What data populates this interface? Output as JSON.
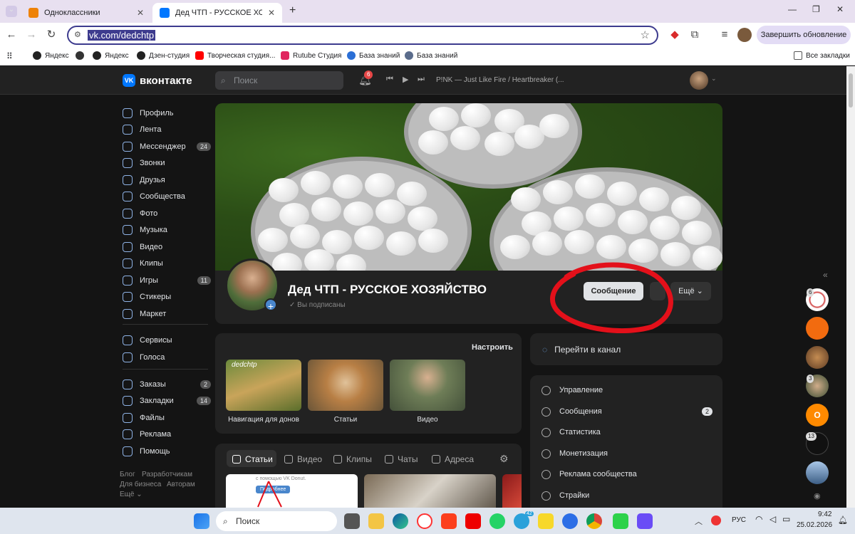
{
  "browser": {
    "tabs": [
      {
        "label": "Одноклассники",
        "active": false
      },
      {
        "label": "Дед ЧТП - РУССКОЕ ХОЗЯЙСТВО",
        "active": true
      }
    ],
    "url": "vk.com/dedchtp",
    "update_button": "Завершить обновление",
    "bookmarks": [
      "Яндекс",
      "Яндекс",
      "Дзен-студия",
      "Творческая студия...",
      "Rutube Студия",
      "База знаний",
      "База знаний"
    ],
    "all_bookmarks": "Все закладки"
  },
  "vk": {
    "logo": "вконтакте",
    "search_placeholder": "Поиск",
    "notif_count": "6",
    "player_track": "P!NK — Just Like Fire / Heartbreaker (...",
    "sidebar": [
      {
        "label": "Профиль",
        "count": ""
      },
      {
        "label": "Лента",
        "count": ""
      },
      {
        "label": "Мессенджер",
        "count": "24"
      },
      {
        "label": "Звонки",
        "count": ""
      },
      {
        "label": "Друзья",
        "count": ""
      },
      {
        "label": "Сообщества",
        "count": ""
      },
      {
        "label": "Фото",
        "count": ""
      },
      {
        "label": "Музыка",
        "count": ""
      },
      {
        "label": "Видео",
        "count": ""
      },
      {
        "label": "Клипы",
        "count": ""
      },
      {
        "label": "Игры",
        "count": "11"
      },
      {
        "label": "Стикеры",
        "count": ""
      },
      {
        "label": "Маркет",
        "count": ""
      },
      {
        "label": "Сервисы",
        "count": ""
      },
      {
        "label": "Голоса",
        "count": ""
      },
      {
        "label": "Заказы",
        "count": "2"
      },
      {
        "label": "Закладки",
        "count": "14"
      },
      {
        "label": "Файлы",
        "count": ""
      },
      {
        "label": "Реклама",
        "count": ""
      },
      {
        "label": "Помощь",
        "count": ""
      }
    ],
    "footer": [
      "Блог",
      "Разработчикам",
      "Для бизнеса",
      "Авторам",
      "Ещё ⌄"
    ],
    "community": {
      "name": "Дед ЧТП - РУССКОЕ ХОЗЯЙСТВО",
      "subscribed": "Вы подписаны",
      "message_button": "Сообщение",
      "more_button": "Ещё"
    },
    "widgets": {
      "configure": "Настроить",
      "tiles": [
        "Навигация для донов",
        "Статьи",
        "Видео"
      ],
      "tile_text": "dedchtp"
    },
    "content_tabs": [
      "Статьи",
      "Видео",
      "Клипы",
      "Чаты",
      "Адреса"
    ],
    "post_preview": {
      "line1": "с помощью VK Donut.",
      "button": "Подробнее"
    },
    "channel_link": "Перейти в канал",
    "manage_menu": [
      {
        "label": "Управление",
        "count": ""
      },
      {
        "label": "Сообщения",
        "count": "2"
      },
      {
        "label": "Статистика",
        "count": ""
      },
      {
        "label": "Монетизация",
        "count": ""
      },
      {
        "label": "Реклама сообщества",
        "count": ""
      },
      {
        "label": "Страйки",
        "count": ""
      }
    ],
    "chat_badges": [
      "6",
      "3",
      "13"
    ],
    "chat_letter": "O"
  },
  "taskbar": {
    "search": "Поиск",
    "lang": "РУС",
    "time": "9:42",
    "date": "25.02.2026",
    "telegram_badge": "42"
  },
  "colors": {
    "vk_blue": "#0077ff",
    "annotation_red": "#e3101a",
    "bg": "#141414",
    "card": "#222222"
  }
}
